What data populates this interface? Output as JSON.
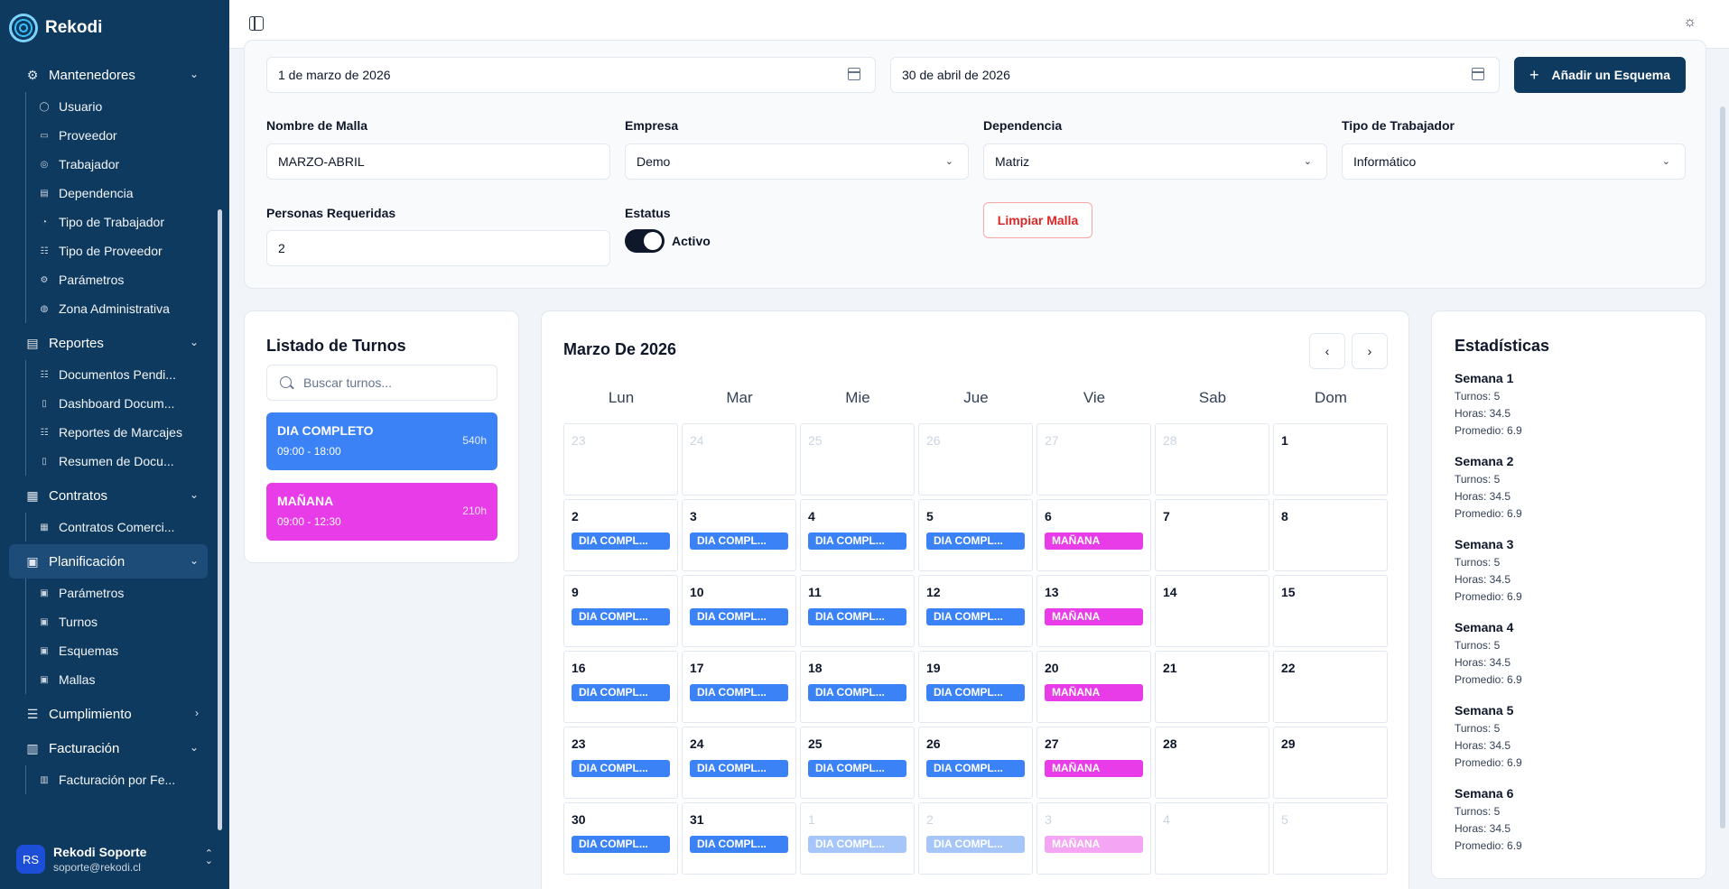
{
  "app": {
    "name": "Rekodi"
  },
  "sidebar": {
    "groups": [
      {
        "label": "Mantenedores",
        "icon": "gear-icon",
        "expanded": true,
        "items": [
          {
            "label": "Usuario",
            "icon": "user-icon"
          },
          {
            "label": "Proveedor",
            "icon": "briefcase-icon"
          },
          {
            "label": "Trabajador",
            "icon": "users-icon"
          },
          {
            "label": "Dependencia",
            "icon": "building-icon"
          },
          {
            "label": "Tipo de Trabajador",
            "icon": "user-cog-icon"
          },
          {
            "label": "Tipo de Proveedor",
            "icon": "list-icon"
          },
          {
            "label": "Parámetros",
            "icon": "gear-icon"
          },
          {
            "label": "Zona Administrativa",
            "icon": "globe-icon"
          }
        ]
      },
      {
        "label": "Reportes",
        "icon": "report-icon",
        "expanded": true,
        "items": [
          {
            "label": "Documentos Pendi...",
            "icon": "list-icon"
          },
          {
            "label": "Dashboard Docum...",
            "icon": "file-icon"
          },
          {
            "label": "Reportes de Marcajes",
            "icon": "list-icon"
          },
          {
            "label": "Resumen de Docu...",
            "icon": "file-icon"
          }
        ]
      },
      {
        "label": "Contratos",
        "icon": "contract-icon",
        "expanded": true,
        "items": [
          {
            "label": "Contratos Comerci...",
            "icon": "contract-icon"
          }
        ]
      },
      {
        "label": "Planificación",
        "icon": "calendar-icon",
        "expanded": true,
        "active": true,
        "items": [
          {
            "label": "Parámetros",
            "icon": "calendar-icon"
          },
          {
            "label": "Turnos",
            "icon": "calendar-icon"
          },
          {
            "label": "Esquemas",
            "icon": "calendar-icon"
          },
          {
            "label": "Mallas",
            "icon": "calendar-icon"
          }
        ]
      },
      {
        "label": "Cumplimiento",
        "icon": "checklist-icon",
        "expanded": false,
        "items": []
      },
      {
        "label": "Facturación",
        "icon": "invoice-icon",
        "expanded": true,
        "items": [
          {
            "label": "Facturación por Fe...",
            "icon": "invoice-icon"
          }
        ]
      }
    ],
    "user": {
      "initials": "RS",
      "name": "Rekodi Soporte",
      "email": "soporte@rekodi.cl"
    }
  },
  "form": {
    "start_date": "1 de marzo de 2026",
    "end_date": "30 de abril de 2026",
    "add_button": "Añadir un Esquema",
    "nombre_label": "Nombre de Malla",
    "nombre_value": "MARZO-ABRIL",
    "empresa_label": "Empresa",
    "empresa_value": "Demo",
    "dependencia_label": "Dependencia",
    "dependencia_value": "Matriz",
    "tipo_label": "Tipo de Trabajador",
    "tipo_value": "Informático",
    "personas_label": "Personas Requeridas",
    "personas_value": "2",
    "estatus_label": "Estatus",
    "estatus_value": "Activo",
    "clear_button": "Limpiar Malla"
  },
  "turnos": {
    "title": "Listado de Turnos",
    "search_placeholder": "Buscar turnos...",
    "items": [
      {
        "name": "DIA COMPLETO",
        "time": "09:00 - 18:00",
        "hours": "540h",
        "color": "#3b82f6"
      },
      {
        "name": "MAÑANA",
        "time": "09:00 - 12:30",
        "hours": "210h",
        "color": "#e83ce8"
      }
    ]
  },
  "calendar": {
    "title": "Marzo De 2026",
    "weekdays": [
      "Lun",
      "Mar",
      "Mie",
      "Jue",
      "Vie",
      "Sab",
      "Dom"
    ],
    "weeks": [
      [
        {
          "d": "23",
          "m": true
        },
        {
          "d": "24",
          "m": true
        },
        {
          "d": "25",
          "m": true
        },
        {
          "d": "26",
          "m": true
        },
        {
          "d": "27",
          "m": true
        },
        {
          "d": "28",
          "m": true
        },
        {
          "d": "1"
        }
      ],
      [
        {
          "d": "2",
          "s": "DIA COMPL...",
          "c": "blue"
        },
        {
          "d": "3",
          "s": "DIA COMPL...",
          "c": "blue"
        },
        {
          "d": "4",
          "s": "DIA COMPL...",
          "c": "blue"
        },
        {
          "d": "5",
          "s": "DIA COMPL...",
          "c": "blue"
        },
        {
          "d": "6",
          "s": "MAÑANA",
          "c": "pink"
        },
        {
          "d": "7"
        },
        {
          "d": "8"
        }
      ],
      [
        {
          "d": "9",
          "s": "DIA COMPL...",
          "c": "blue"
        },
        {
          "d": "10",
          "s": "DIA COMPL...",
          "c": "blue"
        },
        {
          "d": "11",
          "s": "DIA COMPL...",
          "c": "blue"
        },
        {
          "d": "12",
          "s": "DIA COMPL...",
          "c": "blue"
        },
        {
          "d": "13",
          "s": "MAÑANA",
          "c": "pink"
        },
        {
          "d": "14"
        },
        {
          "d": "15"
        }
      ],
      [
        {
          "d": "16",
          "s": "DIA COMPL...",
          "c": "blue"
        },
        {
          "d": "17",
          "s": "DIA COMPL...",
          "c": "blue"
        },
        {
          "d": "18",
          "s": "DIA COMPL...",
          "c": "blue"
        },
        {
          "d": "19",
          "s": "DIA COMPL...",
          "c": "blue"
        },
        {
          "d": "20",
          "s": "MAÑANA",
          "c": "pink"
        },
        {
          "d": "21"
        },
        {
          "d": "22"
        }
      ],
      [
        {
          "d": "23",
          "s": "DIA COMPL...",
          "c": "blue"
        },
        {
          "d": "24",
          "s": "DIA COMPL...",
          "c": "blue"
        },
        {
          "d": "25",
          "s": "DIA COMPL...",
          "c": "blue"
        },
        {
          "d": "26",
          "s": "DIA COMPL...",
          "c": "blue"
        },
        {
          "d": "27",
          "s": "MAÑANA",
          "c": "pink"
        },
        {
          "d": "28"
        },
        {
          "d": "29"
        }
      ],
      [
        {
          "d": "30",
          "s": "DIA COMPL...",
          "c": "blue"
        },
        {
          "d": "31",
          "s": "DIA COMPL...",
          "c": "blue"
        },
        {
          "d": "1",
          "s": "DIA COMPL...",
          "c": "blue",
          "m": true
        },
        {
          "d": "2",
          "s": "DIA COMPL...",
          "c": "blue",
          "m": true
        },
        {
          "d": "3",
          "s": "MAÑANA",
          "c": "pink",
          "m": true
        },
        {
          "d": "4",
          "m": true
        },
        {
          "d": "5",
          "m": true
        }
      ]
    ]
  },
  "stats": {
    "title": "Estadísticas",
    "weeks": [
      {
        "title": "Semana 1",
        "turnos": "Turnos: 5",
        "horas": "Horas: 34.5",
        "promedio": "Promedio: 6.9"
      },
      {
        "title": "Semana 2",
        "turnos": "Turnos: 5",
        "horas": "Horas: 34.5",
        "promedio": "Promedio: 6.9"
      },
      {
        "title": "Semana 3",
        "turnos": "Turnos: 5",
        "horas": "Horas: 34.5",
        "promedio": "Promedio: 6.9"
      },
      {
        "title": "Semana 4",
        "turnos": "Turnos: 5",
        "horas": "Horas: 34.5",
        "promedio": "Promedio: 6.9"
      },
      {
        "title": "Semana 5",
        "turnos": "Turnos: 5",
        "horas": "Horas: 34.5",
        "promedio": "Promedio: 6.9"
      },
      {
        "title": "Semana 6",
        "turnos": "Turnos: 5",
        "horas": "Horas: 34.5",
        "promedio": "Promedio: 6.9"
      }
    ]
  },
  "colors": {
    "sidebar": "#0f3a5f",
    "primary": "#0f3a5f",
    "shift_blue": "#3b82f6",
    "shift_pink": "#e83ce8",
    "danger": "#dc2626"
  }
}
